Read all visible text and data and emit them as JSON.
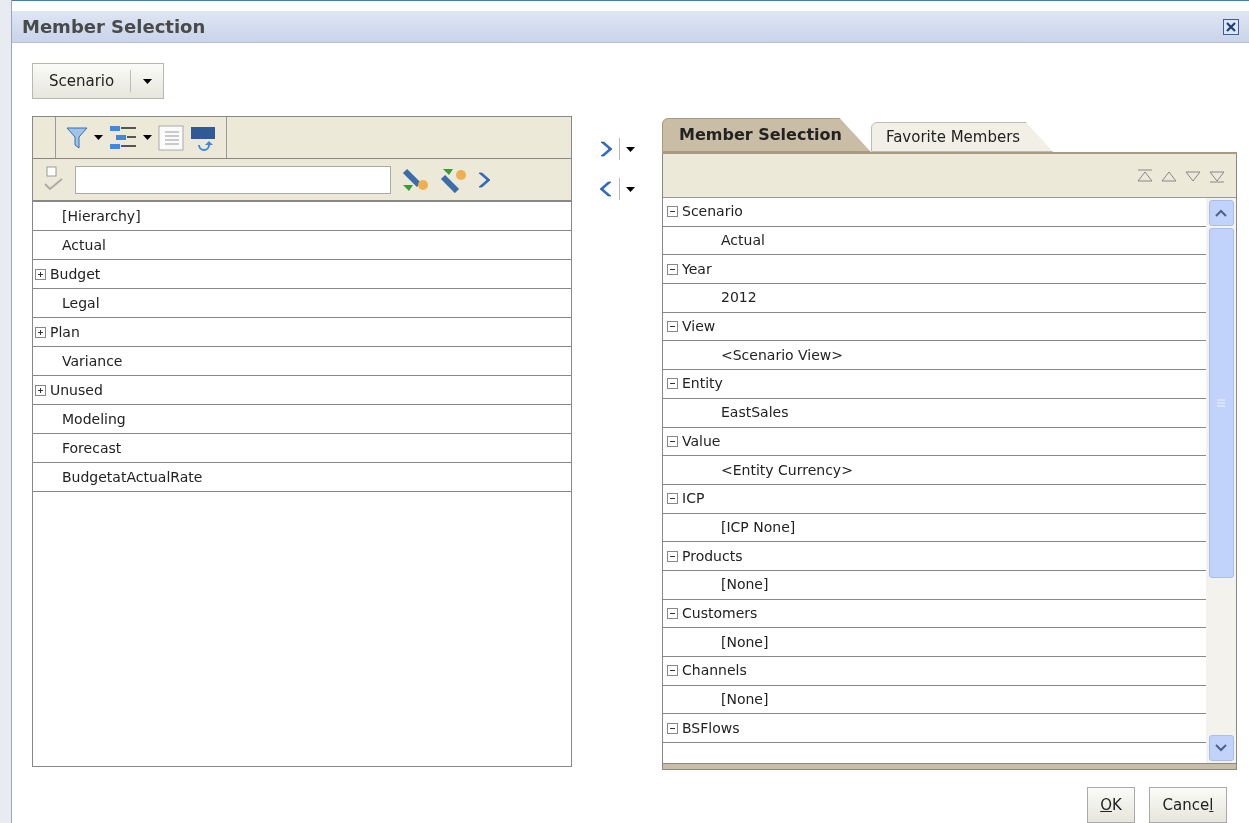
{
  "window": {
    "title": "Member Selection"
  },
  "dimension_dropdown": {
    "label": "Scenario"
  },
  "left_panel": {
    "members": [
      {
        "label": "[Hierarchy]",
        "expandable": false
      },
      {
        "label": "Actual",
        "expandable": false
      },
      {
        "label": "Budget",
        "expandable": true
      },
      {
        "label": "Legal",
        "expandable": false
      },
      {
        "label": "Plan",
        "expandable": true
      },
      {
        "label": "Variance",
        "expandable": false
      },
      {
        "label": "Unused",
        "expandable": true
      },
      {
        "label": "Modeling",
        "expandable": false
      },
      {
        "label": "Forecast",
        "expandable": false
      },
      {
        "label": "BudgetatActualRate",
        "expandable": false
      }
    ]
  },
  "tabs": [
    {
      "label": "Member Selection",
      "selected": true
    },
    {
      "label": "Favorite Members",
      "selected": false
    }
  ],
  "selection": [
    {
      "label": "Scenario",
      "expanded": true,
      "children": [
        {
          "label": "Actual"
        }
      ]
    },
    {
      "label": "Year",
      "expanded": true,
      "children": [
        {
          "label": "2012"
        }
      ]
    },
    {
      "label": "View",
      "expanded": true,
      "children": [
        {
          "label": "<Scenario View>"
        }
      ]
    },
    {
      "label": "Entity",
      "expanded": true,
      "children": [
        {
          "label": "EastSales"
        }
      ]
    },
    {
      "label": "Value",
      "expanded": true,
      "children": [
        {
          "label": "<Entity Currency>"
        }
      ]
    },
    {
      "label": "ICP",
      "expanded": true,
      "children": [
        {
          "label": "[ICP None]"
        }
      ]
    },
    {
      "label": "Products",
      "expanded": true,
      "children": [
        {
          "label": "[None]"
        }
      ]
    },
    {
      "label": "Customers",
      "expanded": true,
      "children": [
        {
          "label": "[None]"
        }
      ]
    },
    {
      "label": "Channels",
      "expanded": true,
      "children": [
        {
          "label": "[None]"
        }
      ]
    },
    {
      "label": "BSFlows",
      "expanded": true
    }
  ],
  "buttons": [
    {
      "key": "O",
      "after": "K"
    },
    {
      "before": "Cance",
      "key": "l"
    }
  ]
}
